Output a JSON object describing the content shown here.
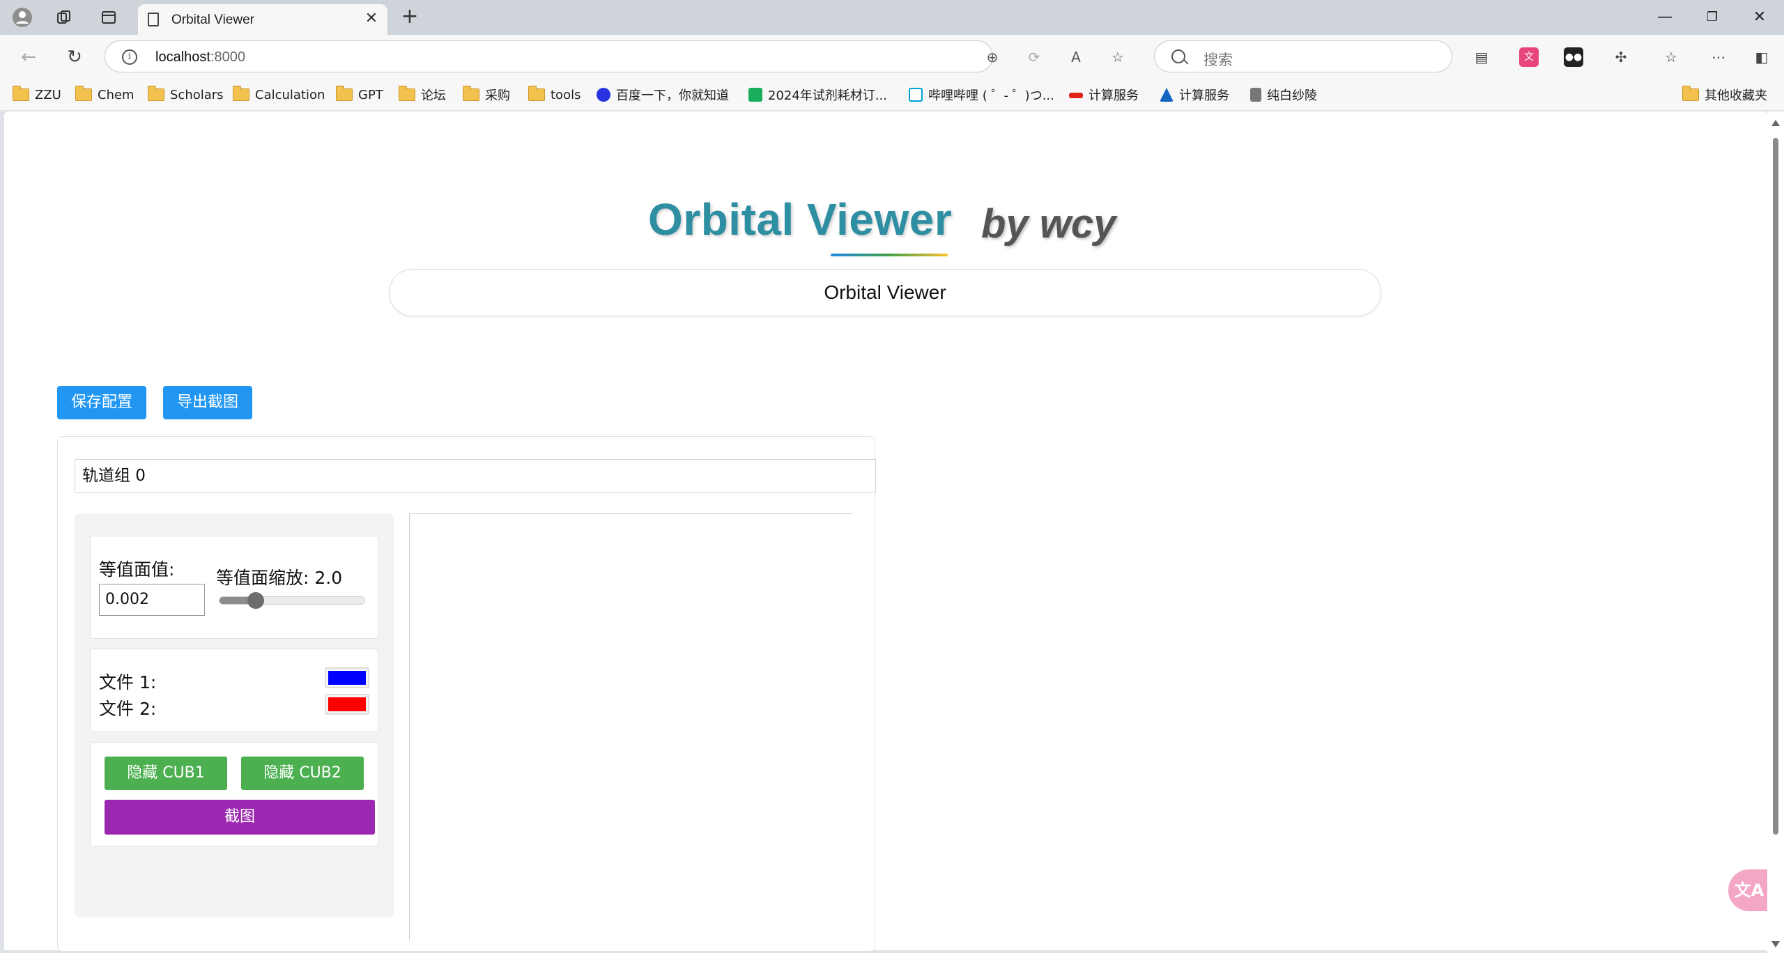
{
  "browser": {
    "tab_title": "Orbital Viewer",
    "url_host": "localhost",
    "url_port": ":8000",
    "search_placeholder": "搜索"
  },
  "bookmarks": [
    {
      "label": "ZZU",
      "icon": "folder-icon"
    },
    {
      "label": "Chem",
      "icon": "folder-icon"
    },
    {
      "label": "Scholars",
      "icon": "folder-icon"
    },
    {
      "label": "Calculation",
      "icon": "folder-icon"
    },
    {
      "label": "GPT",
      "icon": "folder-icon"
    },
    {
      "label": "论坛",
      "icon": "folder-icon"
    },
    {
      "label": "采购",
      "icon": "folder-icon"
    },
    {
      "label": "tools",
      "icon": "folder-icon"
    },
    {
      "label": "百度一下，你就知道",
      "icon": "baidu-icon"
    },
    {
      "label": "2024年试剂耗材订...",
      "icon": "sheet-icon"
    },
    {
      "label": "哔哩哔哩 ( ゜- ゜)つ...",
      "icon": "bilibili-icon"
    },
    {
      "label": "计算服务",
      "icon": "compute-icon"
    },
    {
      "label": "计算服务",
      "icon": "compute2-icon"
    },
    {
      "label": "纯白纱陵",
      "icon": "site-icon"
    },
    {
      "label": "其他收藏夹",
      "icon": "folder-icon"
    }
  ],
  "page": {
    "title": "Orbital Viewer",
    "subtitle": "by wcy",
    "name_value": "Orbital Viewer",
    "save_config": "保存配置",
    "export_screenshot": "导出截图"
  },
  "group": {
    "name_value": "轨道组 0",
    "iso_label": "等值面值:",
    "iso_value": "0.002",
    "scale_label": "等值面缩放: 2.0",
    "scale_fraction": 0.25,
    "file1_label": "文件 1:",
    "file2_label": "文件 2:",
    "file1_color": "#0000ff",
    "file2_color": "#ff0000",
    "hide_cub1": "隐藏 CUB1",
    "hide_cub2": "隐藏 CUB2",
    "screenshot": "截图"
  },
  "colors": {
    "title": "#2e8fa3",
    "blue_button": "#2196f3",
    "green_button": "#4caf50",
    "purple_button": "#9c27b0"
  },
  "translate_fab": "文A"
}
